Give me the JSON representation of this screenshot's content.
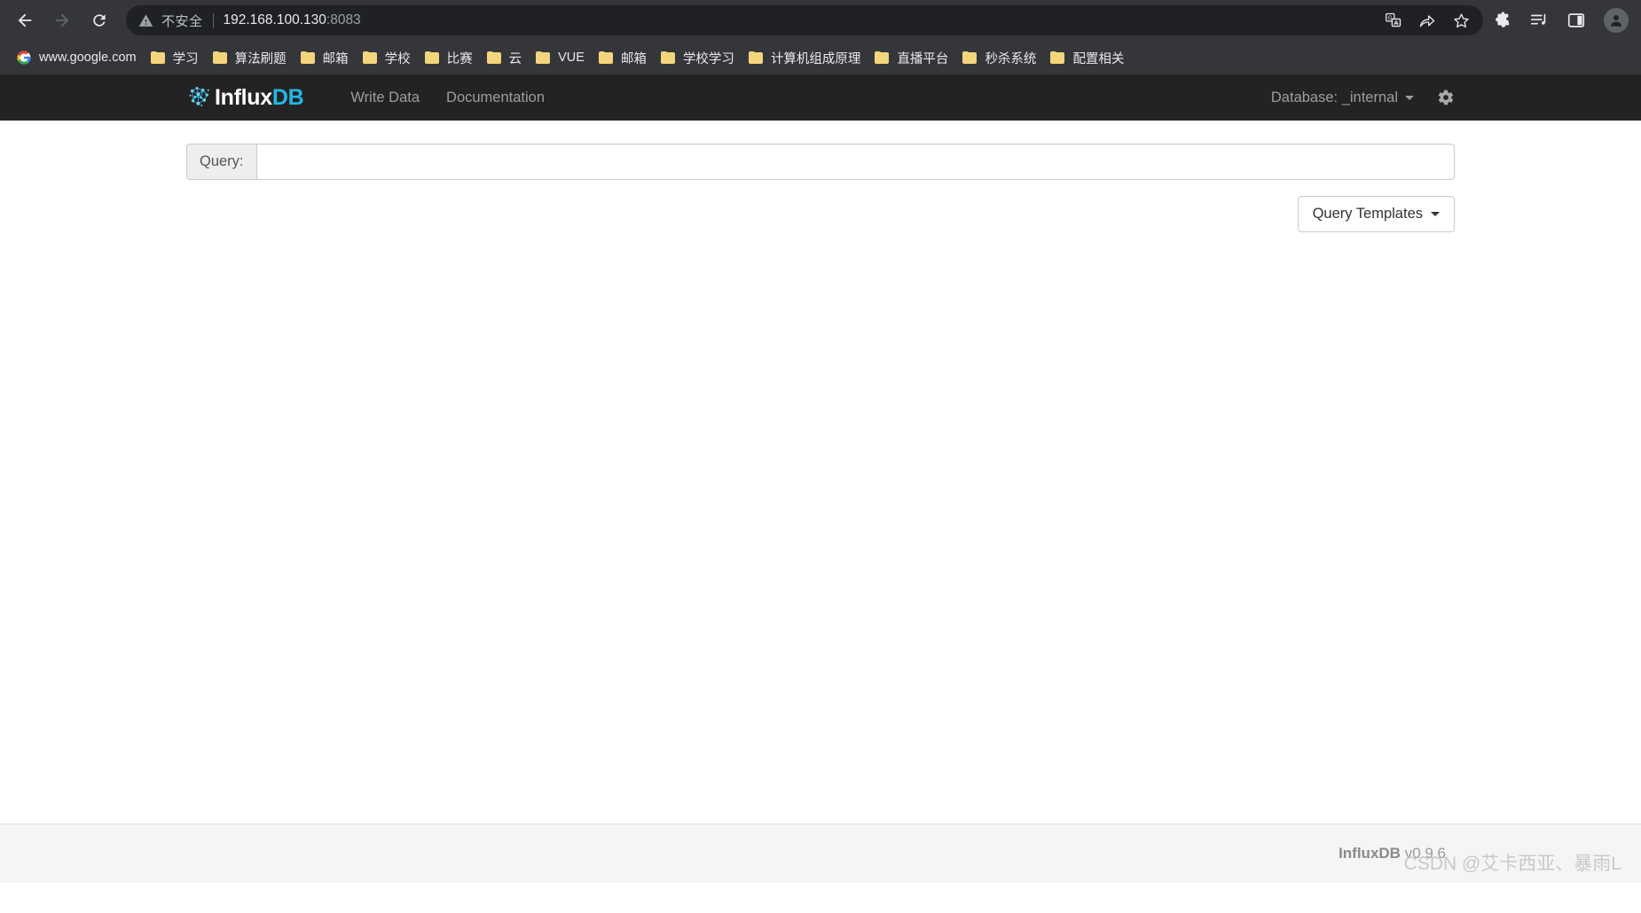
{
  "browser": {
    "back_label": "Back",
    "forward_label": "Forward",
    "reload_label": "Reload",
    "security_text": "不安全",
    "url_host": "192.168.100.130",
    "url_port": ":8083",
    "icons": {
      "back": "back-arrow-icon",
      "forward": "forward-arrow-icon",
      "reload": "reload-icon",
      "warning": "warning-triangle-icon",
      "translate": "translate-icon",
      "share": "share-icon",
      "bookmark_star": "star-icon",
      "extensions": "puzzle-piece-icon",
      "media": "media-playlist-icon",
      "side_panel": "side-panel-icon",
      "profile": "profile-avatar-icon"
    }
  },
  "bookmarks": [
    {
      "label": "www.google.com",
      "icon": "google-icon"
    },
    {
      "label": "学习",
      "icon": "folder-icon"
    },
    {
      "label": "算法刷题",
      "icon": "folder-icon"
    },
    {
      "label": "邮箱",
      "icon": "folder-icon"
    },
    {
      "label": "学校",
      "icon": "folder-icon"
    },
    {
      "label": "比赛",
      "icon": "folder-icon"
    },
    {
      "label": "云",
      "icon": "folder-icon"
    },
    {
      "label": "VUE",
      "icon": "folder-icon"
    },
    {
      "label": "邮箱",
      "icon": "folder-icon"
    },
    {
      "label": "学校学习",
      "icon": "folder-icon"
    },
    {
      "label": "计算机组成原理",
      "icon": "folder-icon"
    },
    {
      "label": "直播平台",
      "icon": "folder-icon"
    },
    {
      "label": "秒杀系统",
      "icon": "folder-icon"
    },
    {
      "label": "配置相关",
      "icon": "folder-icon"
    }
  ],
  "navbar": {
    "brand_primary": "Influx",
    "brand_accent": "DB",
    "links": [
      {
        "label": "Write Data"
      },
      {
        "label": "Documentation"
      }
    ],
    "database_label": "Database: _internal",
    "settings_icon": "gear-icon"
  },
  "main": {
    "query_label": "Query:",
    "query_value": "",
    "query_placeholder": "",
    "templates_button": "Query Templates"
  },
  "footer": {
    "product": "InfluxDB",
    "version": "v0.9.6",
    "watermark": "CSDN @艾卡西亚、暴雨L"
  },
  "colors": {
    "chrome_bg": "#35363a",
    "omnibox_bg": "#202124",
    "influx_navbar_bg": "#232323",
    "brand_accent": "#22b8e6",
    "folder_yellow": "#f3d57c",
    "footer_bg": "#f5f5f5"
  }
}
